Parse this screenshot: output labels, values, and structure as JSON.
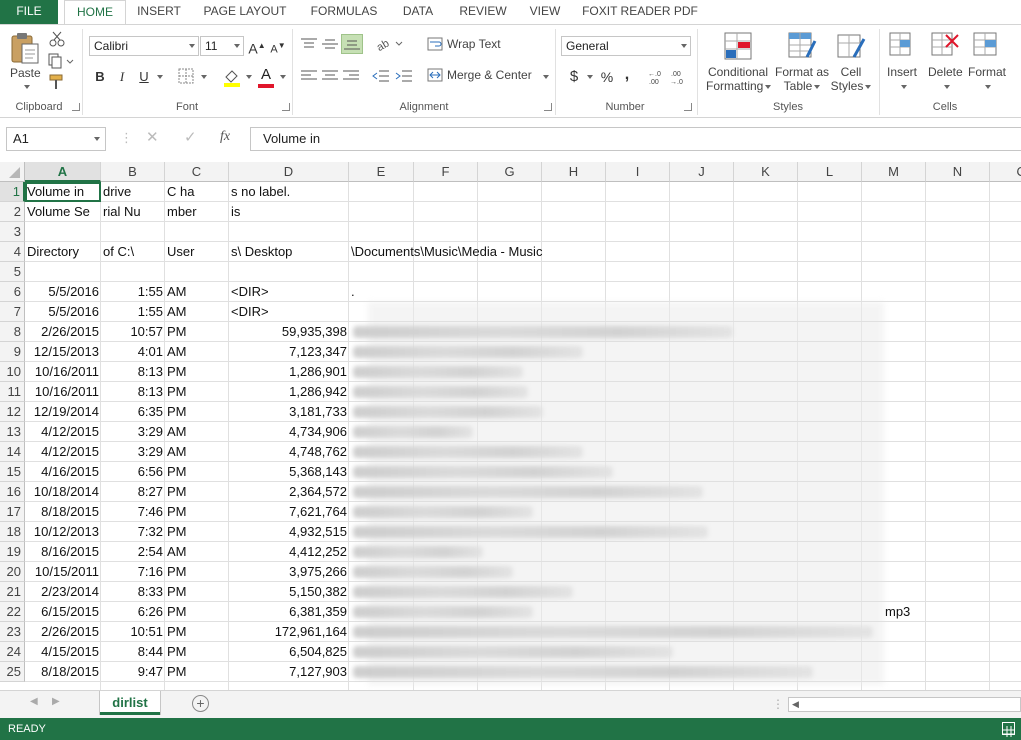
{
  "tabs": [
    "FILE",
    "HOME",
    "INSERT",
    "PAGE LAYOUT",
    "FORMULAS",
    "DATA",
    "REVIEW",
    "VIEW",
    "FOXIT READER PDF"
  ],
  "active_tab": "HOME",
  "ribbon": {
    "clipboard": {
      "label": "Clipboard",
      "paste": "Paste"
    },
    "font": {
      "label": "Font",
      "name": "Calibri",
      "size": "11",
      "bold": "B",
      "italic": "I",
      "underline": "U",
      "grow": "A",
      "shrink": "A",
      "color_letter": "A"
    },
    "alignment": {
      "label": "Alignment",
      "wrap_text": "Wrap Text",
      "merge_center": "Merge & Center"
    },
    "number": {
      "label": "Number",
      "format": "General",
      "currency": "$",
      "percent": "%",
      "comma": ","
    },
    "styles": {
      "label": "Styles",
      "conditional_1": "Conditional",
      "conditional_2": "Formatting",
      "format_as_1": "Format as",
      "format_as_2": "Table",
      "cell_styles_1": "Cell",
      "cell_styles_2": "Styles"
    },
    "cells": {
      "label": "Cells",
      "insert": "Insert",
      "delete": "Delete",
      "format": "Format"
    }
  },
  "formula_bar": {
    "name_box": "A1",
    "fx": "fx",
    "content": "Volume in"
  },
  "columns": [
    "A",
    "B",
    "C",
    "D",
    "E",
    "F",
    "G",
    "H",
    "I",
    "J",
    "K",
    "L",
    "M",
    "N",
    "O"
  ],
  "rows": [
    {
      "n": "1",
      "a": "Volume in",
      "b": "drive",
      "c": "C ha",
      "d": "s no label.",
      "e": ""
    },
    {
      "n": "2",
      "a": "Volume Se",
      "b": "rial Nu",
      "c": "mber",
      "d": "is",
      "e": ""
    },
    {
      "n": "3",
      "a": "",
      "b": "",
      "c": "",
      "d": "",
      "e": ""
    },
    {
      "n": "4",
      "a": "Directory",
      "b": "of C:\\",
      "c": "User",
      "d": "s\\ Desktop",
      "e": "\\Documents\\Music\\Media - Music"
    },
    {
      "n": "5",
      "a": "",
      "b": "",
      "c": "",
      "d": "",
      "e": ""
    },
    {
      "n": "6",
      "a": "5/5/2016",
      "b": "1:55",
      "c": "AM",
      "d": "<DIR>",
      "e": "."
    },
    {
      "n": "7",
      "a": "5/5/2016",
      "b": "1:55",
      "c": "AM",
      "d": "<DIR>",
      "e": ""
    },
    {
      "n": "8",
      "a": "2/26/2015",
      "b": "10:57",
      "c": "PM",
      "d": "59,935,398",
      "e": ""
    },
    {
      "n": "9",
      "a": "12/15/2013",
      "b": "4:01",
      "c": "AM",
      "d": "7,123,347",
      "e": ""
    },
    {
      "n": "10",
      "a": "10/16/2011",
      "b": "8:13",
      "c": "PM",
      "d": "1,286,901",
      "e": ""
    },
    {
      "n": "11",
      "a": "10/16/2011",
      "b": "8:13",
      "c": "PM",
      "d": "1,286,942",
      "e": ""
    },
    {
      "n": "12",
      "a": "12/19/2014",
      "b": "6:35",
      "c": "PM",
      "d": "3,181,733",
      "e": ""
    },
    {
      "n": "13",
      "a": "4/12/2015",
      "b": "3:29",
      "c": "AM",
      "d": "4,734,906",
      "e": ""
    },
    {
      "n": "14",
      "a": "4/12/2015",
      "b": "3:29",
      "c": "AM",
      "d": "4,748,762",
      "e": ""
    },
    {
      "n": "15",
      "a": "4/16/2015",
      "b": "6:56",
      "c": "PM",
      "d": "5,368,143",
      "e": ""
    },
    {
      "n": "16",
      "a": "10/18/2014",
      "b": "8:27",
      "c": "PM",
      "d": "2,364,572",
      "e": ""
    },
    {
      "n": "17",
      "a": "8/18/2015",
      "b": "7:46",
      "c": "PM",
      "d": "7,621,764",
      "e": ""
    },
    {
      "n": "18",
      "a": "10/12/2013",
      "b": "7:32",
      "c": "PM",
      "d": "4,932,515",
      "e": ""
    },
    {
      "n": "19",
      "a": "8/16/2015",
      "b": "2:54",
      "c": "AM",
      "d": "4,412,252",
      "e": ""
    },
    {
      "n": "20",
      "a": "10/15/2011",
      "b": "7:16",
      "c": "PM",
      "d": "3,975,266",
      "e": ""
    },
    {
      "n": "21",
      "a": "2/23/2014",
      "b": "8:33",
      "c": "PM",
      "d": "5,150,382",
      "e": ""
    },
    {
      "n": "22",
      "a": "6/15/2015",
      "b": "6:26",
      "c": "PM",
      "d": "6,381,359",
      "e": "",
      "m": "mp3"
    },
    {
      "n": "23",
      "a": "2/26/2015",
      "b": "10:51",
      "c": "PM",
      "d": "172,961,164",
      "e": ""
    },
    {
      "n": "24",
      "a": "4/15/2015",
      "b": "8:44",
      "c": "PM",
      "d": "6,504,825",
      "e": ""
    },
    {
      "n": "25",
      "a": "8/18/2015",
      "b": "9:47",
      "c": "PM",
      "d": "7,127,903",
      "e": ""
    }
  ],
  "sheet_tab": "dirlist",
  "status": "READY",
  "colors": {
    "excel_green": "#217346",
    "header_bg": "#f3f3f3",
    "grid_line": "#e0e0e0"
  }
}
